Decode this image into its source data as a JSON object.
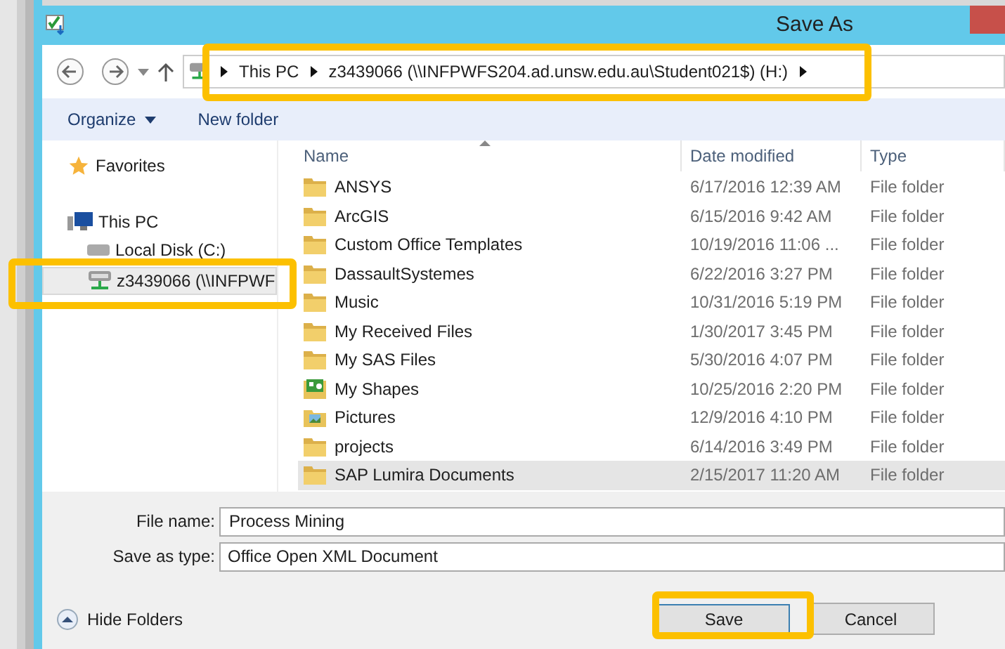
{
  "window": {
    "title": "Save As"
  },
  "address": {
    "crumbs": [
      "This PC",
      "z3439066 (\\\\INFPWFS204.ad.unsw.edu.au\\Student021$) (H:)"
    ]
  },
  "toolbar": {
    "organize": "Organize",
    "new_folder": "New folder"
  },
  "nav": {
    "items": [
      {
        "label": "Favorites",
        "kind": "favorites",
        "selected": false
      },
      {
        "label": "This PC",
        "kind": "pc",
        "selected": false
      },
      {
        "label": "Local Disk (C:)",
        "kind": "disk",
        "selected": false
      },
      {
        "label": "z3439066 (\\\\INFPWF",
        "kind": "network",
        "selected": true
      }
    ]
  },
  "table": {
    "columns": [
      "Name",
      "Date modified",
      "Type"
    ],
    "rows": [
      {
        "kind": "folder",
        "name": "ANSYS",
        "date": "6/17/2016 12:39 AM",
        "type": "File folder",
        "selected": false
      },
      {
        "kind": "folder",
        "name": "ArcGIS",
        "date": "6/15/2016 9:42 AM",
        "type": "File folder",
        "selected": false
      },
      {
        "kind": "folder",
        "name": "Custom Office Templates",
        "date": "10/19/2016 11:06 ...",
        "type": "File folder",
        "selected": false
      },
      {
        "kind": "folder",
        "name": "DassaultSystemes",
        "date": "6/22/2016 3:27 PM",
        "type": "File folder",
        "selected": false
      },
      {
        "kind": "folder",
        "name": "Music",
        "date": "10/31/2016 5:19 PM",
        "type": "File folder",
        "selected": false
      },
      {
        "kind": "folder",
        "name": "My Received Files",
        "date": "1/30/2017 3:45 PM",
        "type": "File folder",
        "selected": false
      },
      {
        "kind": "folder",
        "name": "My SAS Files",
        "date": "5/30/2016 4:07 PM",
        "type": "File folder",
        "selected": false
      },
      {
        "kind": "shapes",
        "name": "My Shapes",
        "date": "10/25/2016 2:20 PM",
        "type": "File folder",
        "selected": false
      },
      {
        "kind": "pictures",
        "name": "Pictures",
        "date": "12/9/2016 4:10 PM",
        "type": "File folder",
        "selected": false
      },
      {
        "kind": "folder",
        "name": "projects",
        "date": "6/14/2016 3:49 PM",
        "type": "File folder",
        "selected": false
      },
      {
        "kind": "folder",
        "name": "SAP Lumira Documents",
        "date": "2/15/2017 11:20 AM",
        "type": "File folder",
        "selected": true
      }
    ]
  },
  "file_name": {
    "label": "File name:",
    "value": "Process Mining"
  },
  "save_type": {
    "label": "Save as type:",
    "value": "Office Open XML Document"
  },
  "hide_folders": "Hide Folders",
  "buttons": {
    "save": "Save",
    "cancel": "Cancel"
  }
}
